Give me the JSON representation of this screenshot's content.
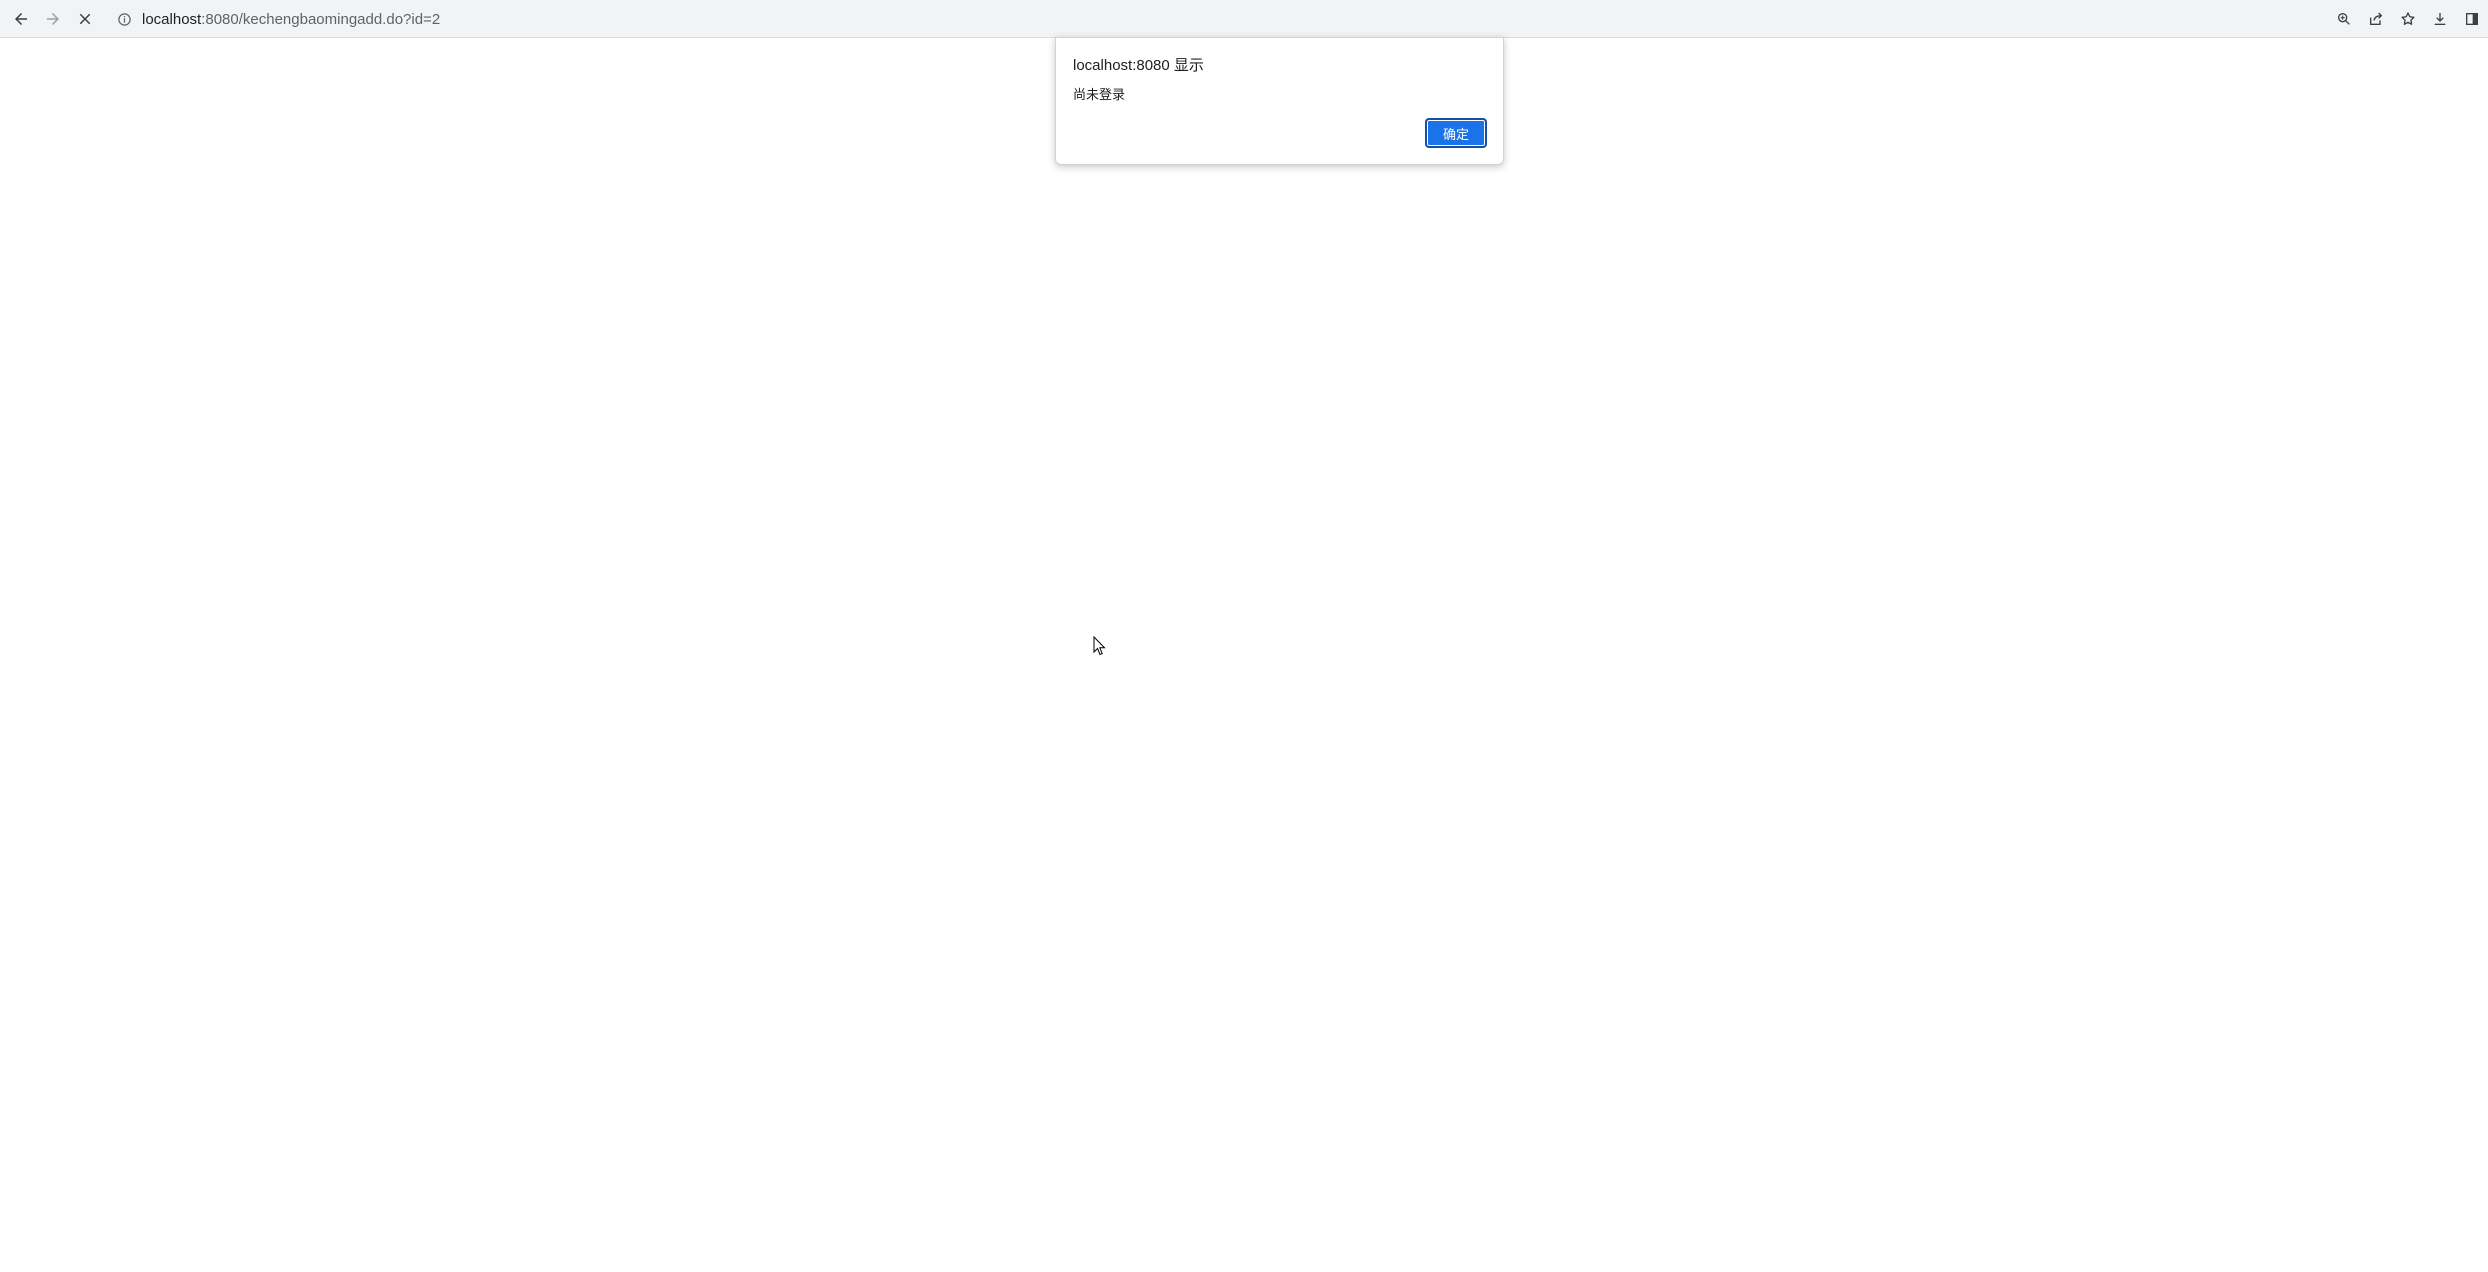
{
  "browser": {
    "url_host": "localhost",
    "url_rest": ":8080/kechengbaomingadd.do?id=2"
  },
  "dialog": {
    "title": "localhost:8080 显示",
    "message": "尚未登录",
    "ok_label": "确定"
  },
  "icons": {
    "back": "arrow-left-icon",
    "forward": "arrow-right-icon",
    "stop": "close-icon",
    "site_info": "info-icon",
    "zoom": "magnifier-icon",
    "share": "share-icon",
    "bookmark": "star-icon",
    "download": "download-icon",
    "side_panel": "side-panel-icon"
  },
  "colors": {
    "accent": "#1a73e8",
    "toolbar_bg": "#f1f3f4"
  }
}
